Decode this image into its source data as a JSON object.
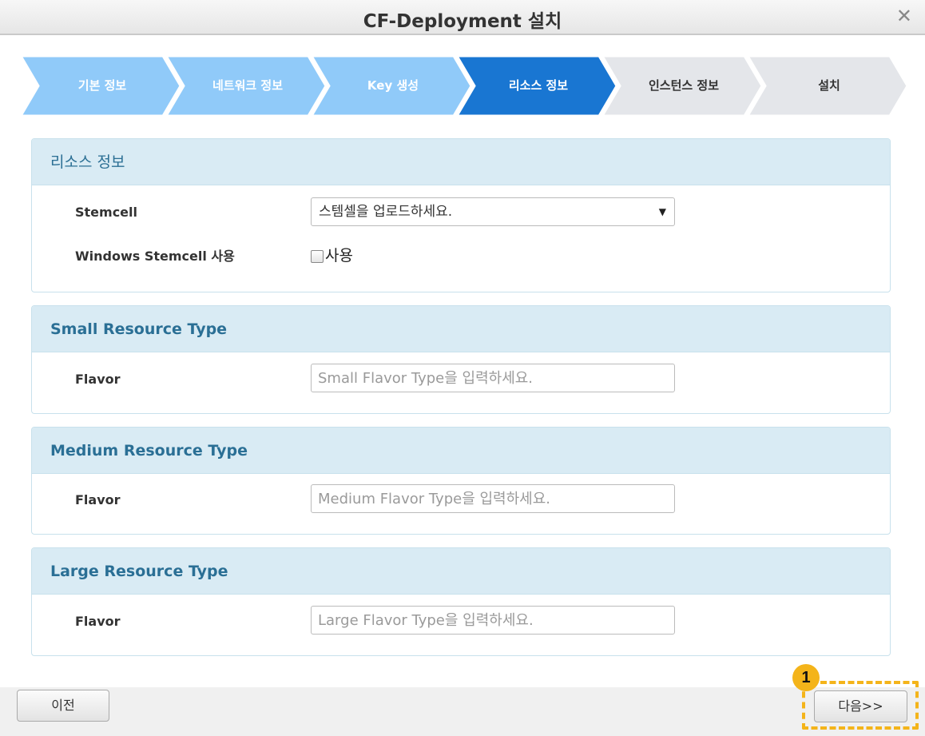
{
  "dialog": {
    "title": "CF-Deployment 설치",
    "close_glyph": "✕"
  },
  "steps": [
    {
      "label": "기본 정보",
      "state": "done"
    },
    {
      "label": "네트워크 정보",
      "state": "done"
    },
    {
      "label": "Key 생성",
      "state": "done"
    },
    {
      "label": "리소스 정보",
      "state": "active"
    },
    {
      "label": "인스턴스 정보",
      "state": "pending"
    },
    {
      "label": "설치",
      "state": "pending"
    }
  ],
  "step_colors": {
    "done": "#90caf9",
    "active": "#1976d2",
    "pending": "#e4e6ea"
  },
  "resource_panel": {
    "title": "리소스 정보",
    "stemcell_label": "Stemcell",
    "stemcell_value": "스템셀을 업로드하세요.",
    "windows_label": "Windows Stemcell 사용",
    "windows_checkbox_label": "사용"
  },
  "small_panel": {
    "title": "Small Resource Type",
    "flavor_label": "Flavor",
    "placeholder": "Small Flavor Type을 입력하세요."
  },
  "medium_panel": {
    "title": "Medium Resource Type",
    "flavor_label": "Flavor",
    "placeholder": "Medium Flavor Type을 입력하세요."
  },
  "large_panel": {
    "title": "Large Resource Type",
    "flavor_label": "Flavor",
    "placeholder": "Large Flavor Type을 입력하세요."
  },
  "footer": {
    "prev_label": "이전",
    "next_label": "다음>>"
  },
  "annotation": {
    "marker_number": "1",
    "color": "#f4b41a"
  }
}
